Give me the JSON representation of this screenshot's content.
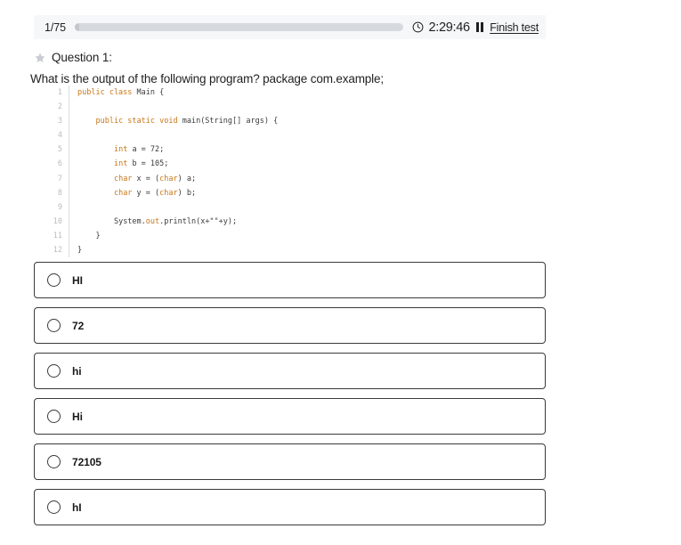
{
  "header": {
    "progress_label": "1/75",
    "progress_percent": 1.33,
    "clock_icon": "clock-icon",
    "timer": "2:29:46",
    "pause_icon": "pause-icon",
    "finish_label": "Finish test"
  },
  "question": {
    "star_icon": "star-icon",
    "label": "Question 1:",
    "prompt": "What is the output of the following program? package com.example;",
    "code_lines": [
      {
        "n": "1",
        "segments": [
          {
            "t": "public class ",
            "c": "kw"
          },
          {
            "t": "Main {",
            "c": ""
          }
        ],
        "indent": 0
      },
      {
        "n": "2",
        "segments": [],
        "indent": 0
      },
      {
        "n": "3",
        "segments": [
          {
            "t": "public static void ",
            "c": "kw"
          },
          {
            "t": "main(String[] args) {",
            "c": ""
          }
        ],
        "indent": 1
      },
      {
        "n": "4",
        "segments": [],
        "indent": 0
      },
      {
        "n": "5",
        "segments": [
          {
            "t": "int ",
            "c": "kw"
          },
          {
            "t": "a = 72;",
            "c": ""
          }
        ],
        "indent": 2
      },
      {
        "n": "6",
        "segments": [
          {
            "t": "int ",
            "c": "kw"
          },
          {
            "t": "b = 105;",
            "c": ""
          }
        ],
        "indent": 2
      },
      {
        "n": "7",
        "segments": [
          {
            "t": "char ",
            "c": "kw"
          },
          {
            "t": "x = (",
            "c": ""
          },
          {
            "t": "char",
            "c": "kw"
          },
          {
            "t": ") a;",
            "c": ""
          }
        ],
        "indent": 2
      },
      {
        "n": "8",
        "segments": [
          {
            "t": "char ",
            "c": "kw"
          },
          {
            "t": "y = (",
            "c": ""
          },
          {
            "t": "char",
            "c": "kw"
          },
          {
            "t": ") b;",
            "c": ""
          }
        ],
        "indent": 2
      },
      {
        "n": "9",
        "segments": [],
        "indent": 0
      },
      {
        "n": "10",
        "segments": [
          {
            "t": "System.",
            "c": ""
          },
          {
            "t": "out",
            "c": "pr"
          },
          {
            "t": ".println(x+\"\"+y);",
            "c": ""
          }
        ],
        "indent": 2
      },
      {
        "n": "11",
        "segments": [
          {
            "t": "}",
            "c": ""
          }
        ],
        "indent": 1
      },
      {
        "n": "12",
        "segments": [
          {
            "t": "}",
            "c": ""
          }
        ],
        "indent": 0
      }
    ]
  },
  "options": [
    {
      "label": "HI",
      "selected": false
    },
    {
      "label": "72",
      "selected": false
    },
    {
      "label": "hi",
      "selected": false
    },
    {
      "label": "Hi",
      "selected": false
    },
    {
      "label": "72105",
      "selected": false
    },
    {
      "label": "hI",
      "selected": false
    }
  ],
  "colors": {
    "keyword": "#c8761a",
    "code_text": "#3b3b3b",
    "line_number": "#b9bcc2",
    "progress_track": "#d6d9de",
    "header_bg": "#f6f7f9",
    "option_border": "#3a3a3a",
    "star": "#c9ccd2"
  }
}
